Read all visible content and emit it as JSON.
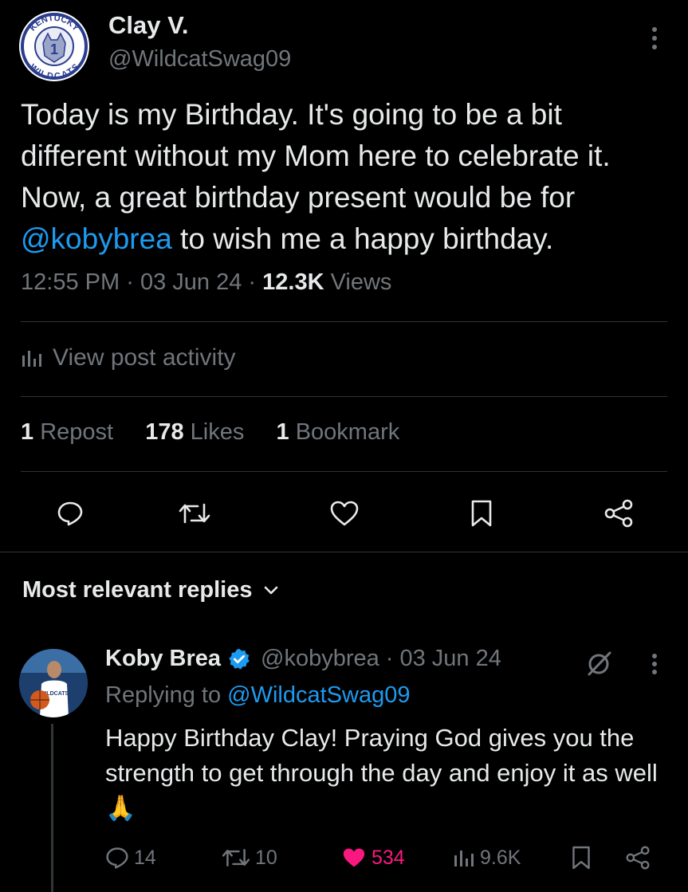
{
  "tweet": {
    "author_name": "Clay V.",
    "author_handle": "@WildcatSwag09",
    "avatar_text_top": "KENTUCKY",
    "avatar_text_bottom": "WILDCATS",
    "avatar_number": "1",
    "text_before_mention": "Today is my Birthday. It's going to be a bit different without my Mom here to celebrate it. Now, a great birthday present would be for ",
    "mention": "@kobybrea",
    "text_after_mention": " to wish me a happy birthday.",
    "time": "12:55 PM",
    "separator": "·",
    "date": "03 Jun 24",
    "views_count": "12.3K",
    "views_label": "Views"
  },
  "activity": {
    "label": "View post activity"
  },
  "stats": {
    "reposts_count": "1",
    "reposts_label": "Repost",
    "likes_count": "178",
    "likes_label": "Likes",
    "bookmarks_count": "1",
    "bookmarks_label": "Bookmark"
  },
  "actions": {
    "reply_icon": "reply-icon",
    "repost_icon": "repost-icon",
    "like_icon": "heart-icon",
    "bookmark_icon": "bookmark-icon",
    "share_icon": "share-icon"
  },
  "replies": {
    "sort_label": "Most relevant replies",
    "items": [
      {
        "name": "Koby Brea",
        "verified": true,
        "handle": "@kobybrea",
        "separator": "·",
        "date": "03 Jun 24",
        "replying_prefix": "Replying to",
        "replying_to": "@WildcatSwag09",
        "text": "Happy Birthday Clay! Praying God gives you the strength to get through the day and enjoy it as well 🙏",
        "avatar_jersey_text": "WILDCATS",
        "reply_count": "14",
        "repost_count": "10",
        "like_count": "534",
        "view_count": "9.6K"
      }
    ]
  },
  "colors": {
    "background": "#000000",
    "text": "#e7e9ea",
    "muted": "#71767b",
    "link": "#1d9bf0",
    "like": "#f91880",
    "divider": "#2f3336"
  }
}
